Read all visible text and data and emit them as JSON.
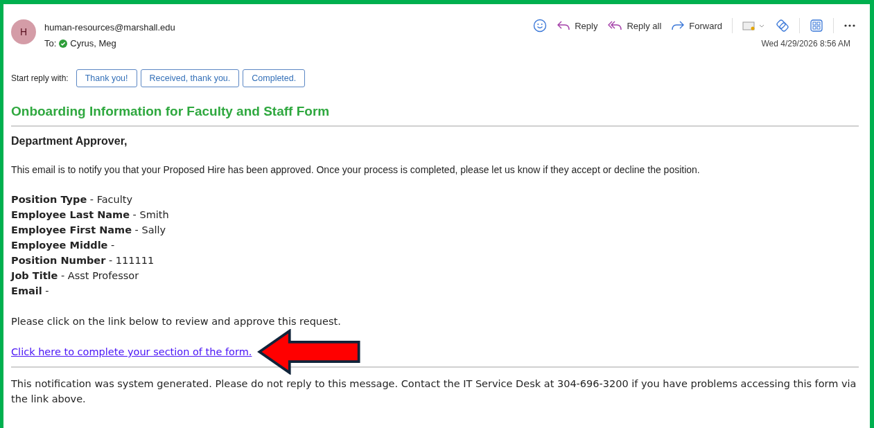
{
  "header": {
    "avatar": "H",
    "sender": "human-resources@marshall.edu",
    "to_label": "To:",
    "recipient": "Cyrus, Meg",
    "date": "Wed 4/29/2026 8:56 AM"
  },
  "toolbar": [
    {
      "kind": "emoji"
    },
    {
      "kind": "reply",
      "label": "Reply"
    },
    {
      "kind": "replyall",
      "label": "Reply all"
    },
    {
      "kind": "forward",
      "label": "Forward"
    },
    {
      "kind": "divider"
    },
    {
      "kind": "tag"
    },
    {
      "kind": "loop"
    },
    {
      "kind": "divider"
    },
    {
      "kind": "apps"
    },
    {
      "kind": "divider"
    },
    {
      "kind": "more"
    }
  ],
  "quick_replies": {
    "label": "Start reply with:",
    "options": [
      "Thank you!",
      "Received, thank you.",
      "Completed."
    ]
  },
  "body": {
    "title": "Onboarding Information for Faculty and Staff Form",
    "greeting": "Department Approver,",
    "intro": "This email is to notify you that your Proposed Hire has been approved. Once your process is completed, please let us know if they accept or decline the position.",
    "fields": [
      "**Position Type** - Faculty",
      "**Employee Last Name** - Smith",
      "**Employee First Name** - Sally",
      "**Employee Middle** -",
      "**Position Number** - 111111",
      "**Job Title** - Asst Professor",
      "**Email** -"
    ],
    "instruction": "Please click on the link below to review and approve this request.",
    "link": "Click here to complete your section of the form.",
    "footer": "This notification was system generated. Please do not reply to this message. Contact the IT Service Desk at 304-696-3200 if you have problems accessing this form via the link above."
  }
}
